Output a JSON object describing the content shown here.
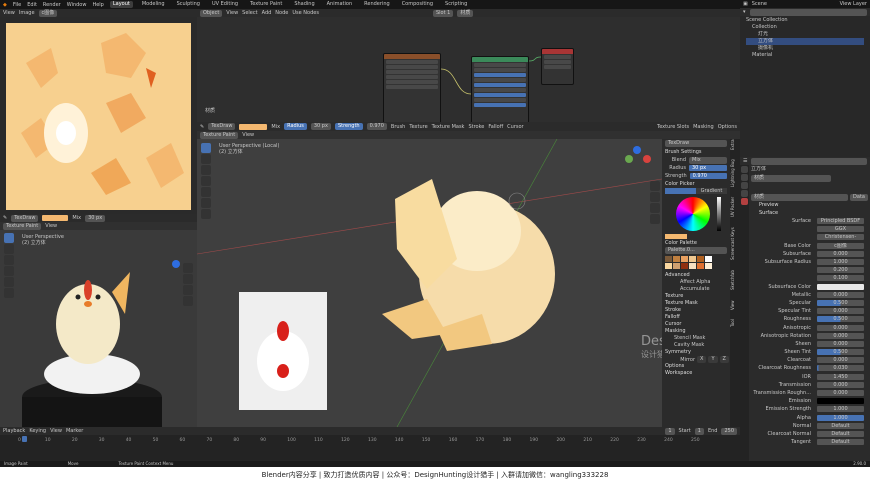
{
  "topbar": {
    "menus": [
      "File",
      "Edit",
      "Render",
      "Window",
      "Help"
    ],
    "workspaces": [
      "Layout",
      "Modeling",
      "Sculpting",
      "UV Editing",
      "Texture Paint",
      "Shading",
      "Animation",
      "Rendering",
      "Compositing",
      "Scripting"
    ],
    "active_workspace": "Layout",
    "scene": "Scene",
    "view_layer": "View Layer"
  },
  "image_editor": {
    "view": "View",
    "image": "Image",
    "image_name": "c图像"
  },
  "node_editor": {
    "mode": "Object",
    "menus": [
      "View",
      "Select",
      "Add",
      "Node"
    ],
    "use_nodes": "Use Nodes",
    "slot": "Slot 1",
    "material": "材质",
    "label": "材质"
  },
  "paint_header": {
    "brush": "TexDraw",
    "blend": "Mix",
    "radius_label": "Radius",
    "radius_value": "30 px",
    "strength_label": "Strength",
    "strength_value": "0.970",
    "brush_menu": "Brush",
    "texture_menu": "Texture",
    "texture_mask": "Texture Mask",
    "stroke": "Stroke",
    "falloff": "Falloff",
    "cursor": "Cursor",
    "texture_slots": "Texture Slots",
    "masking": "Masking",
    "options": "Options"
  },
  "main_viewport": {
    "mode": "Texture Paint",
    "view": "View",
    "perspective": "User Perspective (Local)",
    "collection": "(2) 立方体"
  },
  "left_viewport": {
    "mode": "Texture Paint",
    "view": "View",
    "perspective": "User Perspective",
    "collection": "(2) 立方体"
  },
  "brush_panel": {
    "tool_name": "TexDraw",
    "settings_title": "Brush Settings",
    "blend_label": "Blend",
    "blend_value": "Mix",
    "radius_label": "Radius",
    "radius_value": "30 px",
    "strength_label": "Strength",
    "strength_value": "0.970",
    "color_picker": "Color Picker",
    "gradient": "Gradient",
    "color_palette": "Color Palette",
    "palette_name": "Palette.0...",
    "advanced": "Advanced",
    "affect_alpha": "Affect Alpha",
    "accumulate": "Accumulate",
    "texture": "Texture",
    "texture_mask": "Texture Mask",
    "stroke": "Stroke",
    "falloff": "Falloff",
    "cursor": "Cursor",
    "masking": "Masking",
    "stencil_mask": "Stencil Mask",
    "cavity_mask": "Cavity Mask",
    "symmetry": "Symmetry",
    "mirror": "Mirror",
    "mirror_axes": [
      "X",
      "Y",
      "Z"
    ],
    "options": "Options",
    "workspace": "Workspace",
    "side_tabs": [
      "Tool",
      "View",
      "Sketchfab",
      "Screencast Keys",
      "UV Packer",
      "Lightning Bug",
      "Extra"
    ],
    "swatches": [
      "#7a5a3a",
      "#c08040",
      "#e8a060",
      "#f0c890",
      "#b06020",
      "#ffffff",
      "#fbd8a0",
      "#d0a070",
      "#903010",
      "#f8e0c0",
      "#e07030",
      "#fff0d8"
    ]
  },
  "outliner": {
    "title": "Scene Collection",
    "items": [
      "Collection",
      "灯光",
      "立方体",
      "摄像机",
      "Material"
    ]
  },
  "properties": {
    "object": "立方体",
    "material_name": "材质",
    "slot": "材质",
    "data": "Data",
    "preview": "Preview",
    "surface_section": "Surface",
    "surface_label": "Surface",
    "surface_shader": "Principled BSDF",
    "ggx": "GGX",
    "christensen": "Christensen-Burley",
    "rows": [
      {
        "label": "Base Color",
        "value": "c图像"
      },
      {
        "label": "Subsurface",
        "value": "0.000",
        "fill": 0
      },
      {
        "label": "Subsurface Radius",
        "value": "1.000"
      },
      {
        "label": "",
        "value": "0.200"
      },
      {
        "label": "",
        "value": "0.100"
      },
      {
        "label": "Subsurface Color",
        "value": ""
      },
      {
        "label": "Metallic",
        "value": "0.000",
        "fill": 0
      },
      {
        "label": "Specular",
        "value": "0.500",
        "fill": 0.5
      },
      {
        "label": "Specular Tint",
        "value": "0.000",
        "fill": 0
      },
      {
        "label": "Roughness",
        "value": "0.500",
        "fill": 0.5
      },
      {
        "label": "Anisotropic",
        "value": "0.000",
        "fill": 0
      },
      {
        "label": "Anisotropic Rotation",
        "value": "0.000",
        "fill": 0
      },
      {
        "label": "Sheen",
        "value": "0.000",
        "fill": 0
      },
      {
        "label": "Sheen Tint",
        "value": "0.500",
        "fill": 0.5
      },
      {
        "label": "Clearcoat",
        "value": "0.000",
        "fill": 0
      },
      {
        "label": "Clearcoat Roughness",
        "value": "0.030",
        "fill": 0.03
      },
      {
        "label": "IOR",
        "value": "1.450"
      },
      {
        "label": "Transmission",
        "value": "0.000",
        "fill": 0
      },
      {
        "label": "Transmission Roughn...",
        "value": "0.000",
        "fill": 0
      },
      {
        "label": "Emission",
        "value": ""
      },
      {
        "label": "Emission Strength",
        "value": "1.000"
      },
      {
        "label": "Alpha",
        "value": "1.000",
        "fill": 1
      },
      {
        "label": "Normal",
        "value": "Default"
      },
      {
        "label": "Clearcoat Normal",
        "value": "Default"
      },
      {
        "label": "Tangent",
        "value": "Default"
      }
    ]
  },
  "timeline": {
    "menus": [
      "Playback",
      "Keying",
      "View",
      "Marker"
    ],
    "start_label": "Start",
    "start": "1",
    "end_label": "End",
    "end": "250",
    "current": "1",
    "ticks": [
      "0",
      "10",
      "20",
      "30",
      "40",
      "50",
      "60",
      "70",
      "80",
      "90",
      "100",
      "110",
      "120",
      "130",
      "140",
      "150",
      "160",
      "170",
      "180",
      "190",
      "200",
      "210",
      "220",
      "230",
      "240",
      "250"
    ]
  },
  "statusbar": {
    "items": [
      "Image Paint",
      "Move",
      "Texture Paint Context Menu"
    ],
    "version": "2.90.0"
  },
  "watermark": {
    "line1": "DesignHunting",
    "line2": "设计猎手公众号-基础部分"
  },
  "banner": {
    "text": "Blender内容分享  |  致力打造优质内容  |  公众号：DesignHunting设计猎手  |  入群请加微信：wangling333228"
  },
  "colors": {
    "accent": "#4772b3",
    "paint": "#f4b870",
    "header": "#2b2b2b",
    "uv_bg": "#f7d08f"
  }
}
